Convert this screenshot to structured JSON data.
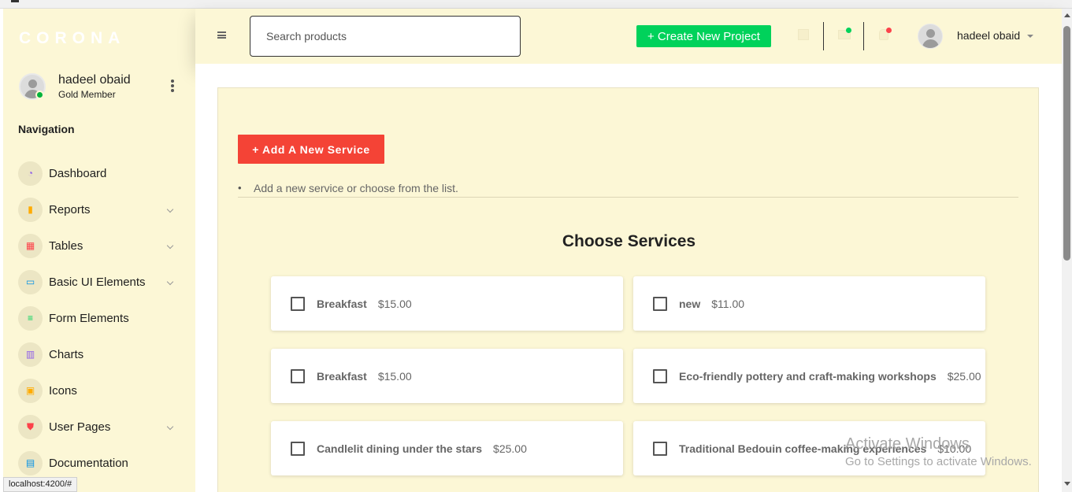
{
  "brand": {
    "name": "CORONA"
  },
  "sidebar": {
    "profile": {
      "name": "hadeel obaid",
      "role": "Gold Member"
    },
    "nav_heading": "Navigation",
    "items": [
      {
        "label": "Dashboard",
        "icon": "speedometer-icon",
        "icon_color": "#8f5fe8",
        "expandable": false
      },
      {
        "label": "Reports",
        "icon": "bar-chart-icon",
        "icon_color": "#ffab00",
        "expandable": true
      },
      {
        "label": "Tables",
        "icon": "table-icon",
        "icon_color": "#fc424a",
        "expandable": true
      },
      {
        "label": "Basic UI Elements",
        "icon": "laptop-icon",
        "icon_color": "#0090e7",
        "expandable": true
      },
      {
        "label": "Form Elements",
        "icon": "playlist-icon",
        "icon_color": "#00d25b",
        "expandable": false
      },
      {
        "label": "Charts",
        "icon": "chart-icon",
        "icon_color": "#8f5fe8",
        "expandable": false
      },
      {
        "label": "Icons",
        "icon": "contacts-icon",
        "icon_color": "#ffab00",
        "expandable": false
      },
      {
        "label": "User Pages",
        "icon": "security-icon",
        "icon_color": "#fc424a",
        "expandable": true
      },
      {
        "label": "Documentation",
        "icon": "file-document-icon",
        "icon_color": "#0090e7",
        "expandable": false
      }
    ]
  },
  "header": {
    "search_placeholder": "Search products",
    "create_button": "+ Create New Project",
    "user_name": "hadeel obaid"
  },
  "main": {
    "add_button": "+ Add A New Service",
    "hint": "Add a new service or choose from the list.",
    "section_title": "Choose Services",
    "services": [
      {
        "name": "Breakfast",
        "price": "$15.00",
        "checked": false
      },
      {
        "name": "new",
        "price": "$11.00",
        "checked": false
      },
      {
        "name": "Breakfast",
        "price": "$15.00",
        "checked": false
      },
      {
        "name": "Eco-friendly pottery and craft-making workshops",
        "price": "$25.00",
        "checked": false
      },
      {
        "name": "Candlelit dining under the stars",
        "price": "$25.00",
        "checked": false
      },
      {
        "name": "Traditional Bedouin coffee-making experiences",
        "price": "$10.00",
        "checked": false
      }
    ]
  },
  "status_url": "localhost:4200/#",
  "watermark": {
    "line1": "Activate Windows",
    "line2": "Go to Settings to activate Windows."
  },
  "colors": {
    "sidebar_bg": "#fcf7d6",
    "accent_green": "#00d25b",
    "accent_red": "#f44336"
  }
}
